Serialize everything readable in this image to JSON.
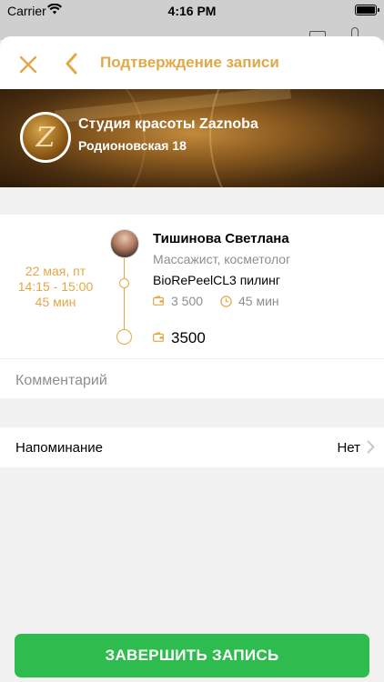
{
  "status_bar": {
    "carrier": "Carrier",
    "time": "4:16 PM",
    "icons": [
      "wifi-icon",
      "battery-icon"
    ]
  },
  "nav": {
    "title": "Подтверждение записи",
    "accent_color": "#e2a847"
  },
  "salon": {
    "name": "Студия красоты Zaznoba",
    "address": "Родионовская 18",
    "logo_letter": "Z"
  },
  "booking": {
    "date": "22 мая, пт",
    "time_range": "14:15 - 15:00",
    "duration": "45 мин",
    "master": {
      "name": "Тишинова Светлана",
      "role": "Массажист, косметолог"
    },
    "service": {
      "name": "BioRePeelCL3 пилинг",
      "price": "3 500",
      "duration": "45 мин"
    },
    "total": "3500"
  },
  "comment": {
    "placeholder": "Комментарий"
  },
  "reminder": {
    "label": "Напоминание",
    "value": "Нет"
  },
  "submit": {
    "label": "ЗАВЕРШИТЬ ЗАПИСЬ",
    "color": "#2fbc4e"
  }
}
